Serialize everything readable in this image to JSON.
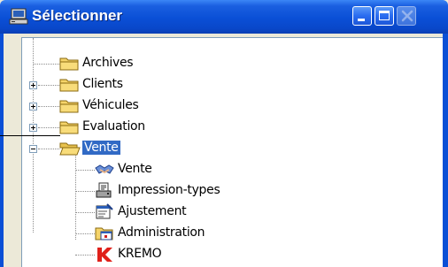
{
  "window": {
    "title": "Sélectionner",
    "controls": {
      "minimize": "minimize",
      "maximize": "maximize",
      "close": "close"
    }
  },
  "tree": {
    "nodes": [
      {
        "label": "Archives",
        "icon": "folder-icon",
        "expander": "none",
        "selected": false
      },
      {
        "label": "Clients",
        "icon": "folder-icon",
        "expander": "plus",
        "selected": false
      },
      {
        "label": "Véhicules",
        "icon": "folder-icon",
        "expander": "plus",
        "selected": false
      },
      {
        "label": "Evaluation",
        "icon": "folder-icon",
        "expander": "plus",
        "selected": false
      },
      {
        "label": "Vente",
        "icon": "open-folder-icon",
        "expander": "minus",
        "selected": true
      },
      {
        "label": "Vente",
        "icon": "handshake-icon",
        "expander": "none",
        "selected": false
      },
      {
        "label": "Impression-types",
        "icon": "printer-document-icon",
        "expander": "none",
        "selected": false
      },
      {
        "label": "Ajustement",
        "icon": "adjustment-form-icon",
        "expander": "none",
        "selected": false
      },
      {
        "label": "Administration",
        "icon": "calendar-window-icon",
        "expander": "none",
        "selected": false
      },
      {
        "label": "KREMO",
        "icon": "kremo-logo-icon",
        "expander": "none",
        "selected": false
      }
    ]
  },
  "colors": {
    "titlebar": "#0a4fd6",
    "selection": "#316ac5",
    "folder": "#f5d46a",
    "kremo_red": "#e0201a"
  }
}
